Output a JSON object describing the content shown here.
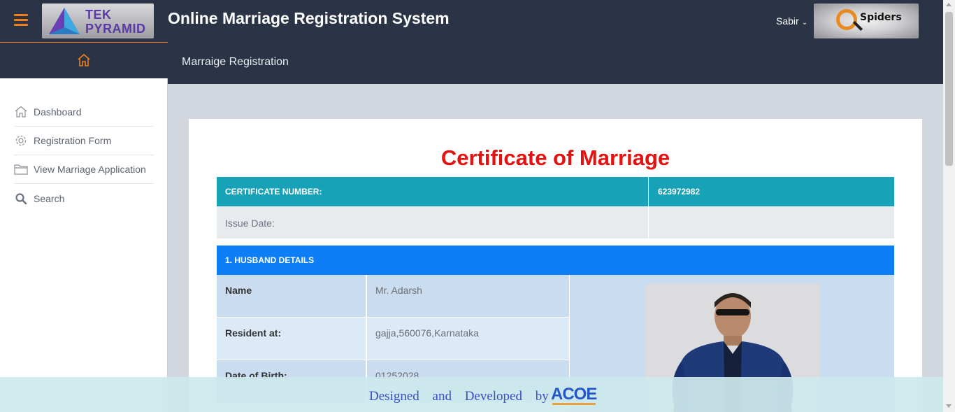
{
  "header": {
    "logo_left_line1": "TEK",
    "logo_left_line2": "PYRAMID",
    "app_title": "Online Marriage Registration System",
    "user_name": "Sabir",
    "logo_right_text": "Spiders",
    "accent_color": "#f07d1a",
    "bar_color": "#2b3446"
  },
  "content_header": {
    "page_title": "Marraige Registration"
  },
  "sidebar": {
    "home_icon": "home-icon",
    "items": [
      {
        "label": "Dashboard",
        "icon": "home-icon"
      },
      {
        "label": "Registration Form",
        "icon": "gear-icon"
      },
      {
        "label": "View Marriage Application",
        "icon": "folder-icon"
      },
      {
        "label": "Search",
        "icon": "search-icon"
      }
    ]
  },
  "certificate": {
    "title": "Certificate of Marriage",
    "title_color": "#e3110f",
    "number_label": "CERTIFICATE NUMBER:",
    "number_value": "623972982",
    "issue_label": "Issue Date:",
    "issue_value": "",
    "husband_section": "1. HUSBAND DETAILS",
    "husband_rows": [
      {
        "label": "Name",
        "value": "Mr. Adarsh"
      },
      {
        "label": "Resident at:",
        "value": "gajja,560076,Karnataka"
      },
      {
        "label": "Date of Birth:",
        "value": "01252028"
      }
    ]
  },
  "footer": {
    "text": "Designed and Developed by",
    "logo_text": "ACOE"
  }
}
